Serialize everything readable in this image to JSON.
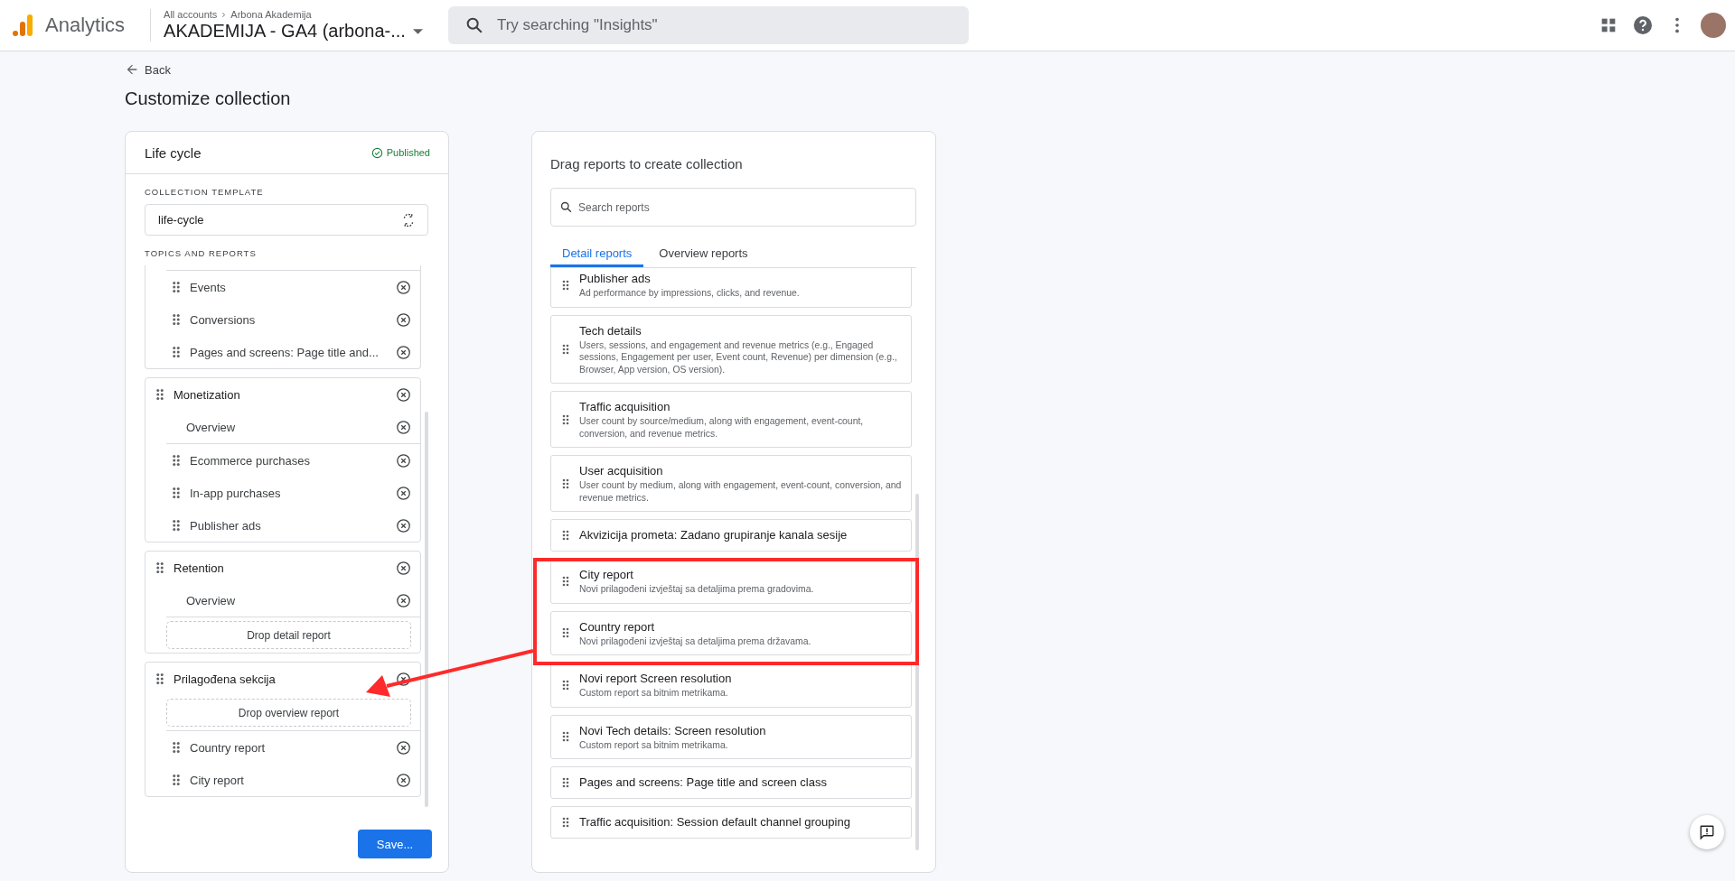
{
  "topbar": {
    "product": "Analytics",
    "breadcrumb": [
      "All accounts",
      "Arbona Akademija"
    ],
    "property": "AKADEMIJA - GA4 (arbona-...",
    "search_placeholder": "Try searching \"Insights\""
  },
  "page": {
    "back": "Back",
    "title": "Customize collection"
  },
  "collection": {
    "name": "Life cycle",
    "status": "Published",
    "template_label": "COLLECTION TEMPLATE",
    "template_value": "life-cycle",
    "topics_label": "TOPICS AND REPORTS",
    "groups": [
      {
        "items": [
          {
            "kind": "report",
            "label": "Events"
          },
          {
            "kind": "report",
            "label": "Conversions"
          },
          {
            "kind": "report",
            "label": "Pages and screens: Page title and..."
          }
        ]
      },
      {
        "title": "Monetization",
        "items": [
          {
            "kind": "overview",
            "label": "Overview"
          },
          {
            "kind": "report",
            "label": "Ecommerce purchases"
          },
          {
            "kind": "report",
            "label": "In-app purchases"
          },
          {
            "kind": "report",
            "label": "Publisher ads"
          }
        ]
      },
      {
        "title": "Retention",
        "items": [
          {
            "kind": "overview",
            "label": "Overview"
          },
          {
            "kind": "drop",
            "label": "Drop detail report"
          }
        ]
      },
      {
        "title": "Prilagođena sekcija",
        "items": [
          {
            "kind": "drop",
            "label": "Drop overview report"
          },
          {
            "kind": "report",
            "label": "Country report"
          },
          {
            "kind": "report",
            "label": "City report"
          }
        ]
      }
    ],
    "save": "Save..."
  },
  "library": {
    "heading": "Drag reports to create collection",
    "search_placeholder": "Search reports",
    "tabs": [
      {
        "label": "Detail reports",
        "selected": true
      },
      {
        "label": "Overview reports",
        "selected": false
      }
    ],
    "reports": [
      {
        "title": "Publisher ads",
        "description": "Ad performance by impressions, clicks, and revenue."
      },
      {
        "title": "Tech details",
        "description": "Users, sessions, and engagement and revenue metrics (e.g., Engaged sessions, Engagement per user, Event count, Revenue) per dimension (e.g., Browser, App version, OS version)."
      },
      {
        "title": "Traffic acquisition",
        "description": "User count by source/medium, along with engagement, event-count, conversion, and revenue metrics."
      },
      {
        "title": "User acquisition",
        "description": "User count by medium, along with engagement, event-count, conversion, and revenue metrics."
      },
      {
        "title": "Akvizicija prometa: Zadano grupiranje kanala sesije"
      },
      {
        "title": "City report",
        "description": "Novi prilagođeni izvještaj sa detaljima prema gradovima."
      },
      {
        "title": "Country report",
        "description": "Novi prilagođeni izvještaj sa detaljima prema državama."
      },
      {
        "title": "Novi report Screen resolution",
        "description": "Custom report sa bitnim metrikama."
      },
      {
        "title": "Novi Tech details: Screen resolution",
        "description": "Custom report sa bitnim metrikama."
      },
      {
        "title": "Pages and screens: Page title and screen class"
      },
      {
        "title": "Traffic acquisition: Session default channel grouping"
      }
    ]
  }
}
